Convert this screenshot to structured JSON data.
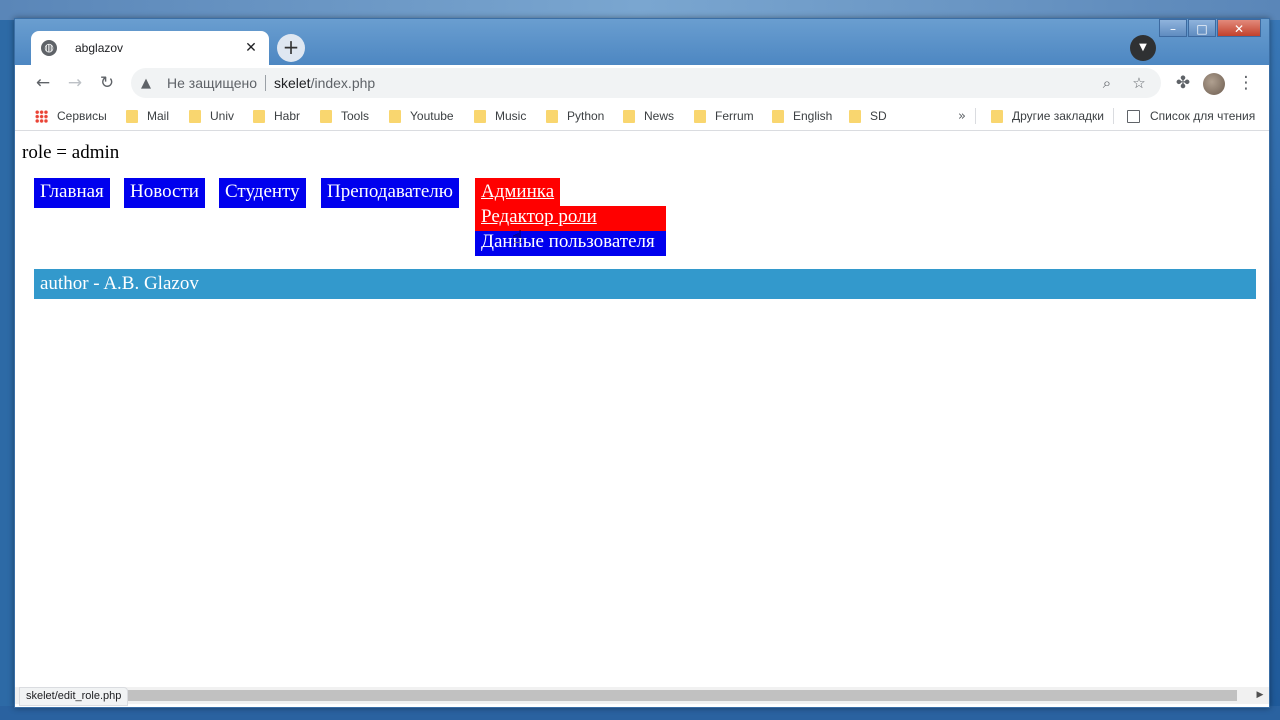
{
  "browser": {
    "tab_title": "abglazov",
    "tab_favicon": "globe-icon",
    "omnibox": {
      "security_label": "Не защищено",
      "url_host": "skelet",
      "url_path": "/index.php"
    },
    "bookmarks": [
      {
        "label": "Сервисы",
        "icon": "apps-icon"
      },
      {
        "label": "Mail",
        "icon": "folder-icon"
      },
      {
        "label": "Univ",
        "icon": "folder-icon"
      },
      {
        "label": "Habr",
        "icon": "folder-icon"
      },
      {
        "label": "Tools",
        "icon": "folder-icon"
      },
      {
        "label": "Youtube",
        "icon": "folder-icon"
      },
      {
        "label": "Music",
        "icon": "folder-icon"
      },
      {
        "label": "Python",
        "icon": "folder-icon"
      },
      {
        "label": "News",
        "icon": "folder-icon"
      },
      {
        "label": "Ferrum",
        "icon": "folder-icon"
      },
      {
        "label": "English",
        "icon": "folder-icon"
      },
      {
        "label": "SD",
        "icon": "folder-icon"
      }
    ],
    "other_bookmarks": "Другие закладки",
    "reading_list": "Список для чтения",
    "status_url": "skelet/edit_role.php"
  },
  "page": {
    "role_line": "role = admin",
    "nav": [
      {
        "label": "Главная"
      },
      {
        "label": "Новости"
      },
      {
        "label": "Студенту"
      },
      {
        "label": "Преподавателю"
      },
      {
        "label": "Админка"
      }
    ],
    "admin_submenu": [
      {
        "label": "Редактор роли"
      },
      {
        "label": "Данные пользователя"
      }
    ],
    "footer": "author - A.B. Glazov"
  },
  "colors": {
    "nav_bg": "#0000ee",
    "nav_active_bg": "#ff0000",
    "footer_bg": "#3399cc"
  }
}
